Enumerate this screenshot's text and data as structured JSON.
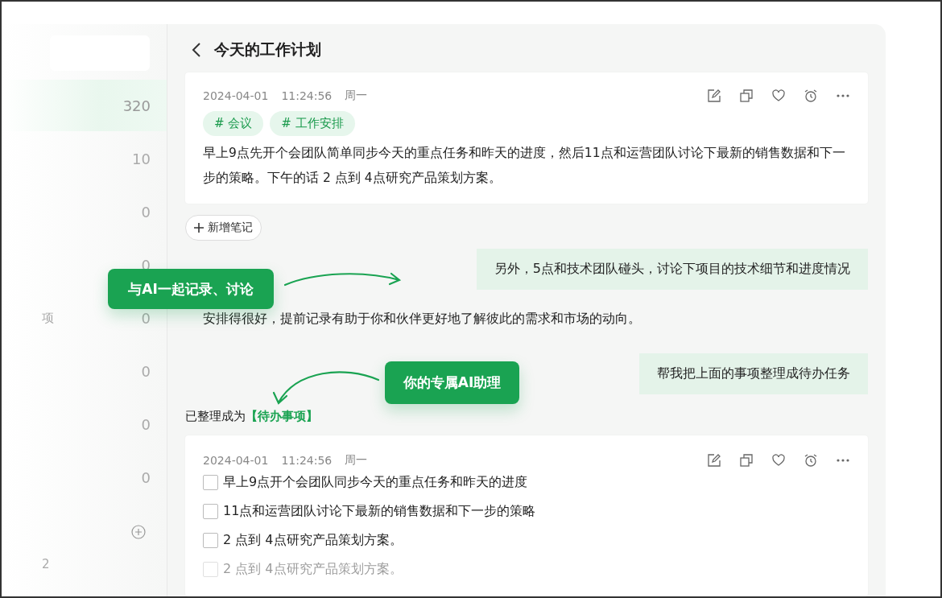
{
  "sidebar": {
    "items": [
      {
        "count": "320",
        "selected": true
      },
      {
        "count": "10",
        "selected": false
      },
      {
        "count": "0",
        "selected": false
      },
      {
        "count": "0",
        "selected": false
      },
      {
        "label": "项",
        "count": "0",
        "selected": false
      },
      {
        "count": "0",
        "selected": false
      },
      {
        "count": "0",
        "selected": false
      },
      {
        "count": "0",
        "selected": false
      }
    ],
    "footer_text": "2"
  },
  "main": {
    "title": "今天的工作计划",
    "note": {
      "date": "2024-04-01",
      "time": "11:24:56",
      "weekday": "周一",
      "tags": [
        "# 会议",
        "# 工作安排"
      ],
      "text": "早上9点先开个会团队简单同步今天的重点任务和昨天的进度，然后11点和运营团队讨论下最新的销售数据和下一步的策略。下午的话 2 点到 4点研究产品策划方案。"
    },
    "add_note_button": "新增笔记",
    "messages": [
      {
        "kind": "user",
        "text": "另外，5点和技术团队碰头，讨论下项目的技术细节和进度情况"
      },
      {
        "kind": "ai",
        "text": "安排得很好，提前记录有助于你和伙伴更好地了解彼此的需求和市场的动向。"
      },
      {
        "kind": "user",
        "text": "帮我把上面的事项整理成待办任务"
      }
    ],
    "result_text": "已整理成为**【待办事项】**",
    "todo_note": {
      "date": "2024-04-01",
      "time": "11:24:56",
      "weekday": "周一",
      "items": [
        {
          "text": "早上9点开个会团队同步今天的重点任务和昨天的进度",
          "checked": false
        },
        {
          "text": "11点和运营团队讨论下最新的销售数据和下一步的策略",
          "checked": false
        },
        {
          "text": " 2 点到 4点研究产品策划方案。",
          "checked": false
        },
        {
          "text": " 2 点到 4点研究产品策划方案。",
          "checked": false
        }
      ]
    }
  },
  "callouts": [
    "与AI一起记录、讨论",
    "你的专属AI助理"
  ]
}
